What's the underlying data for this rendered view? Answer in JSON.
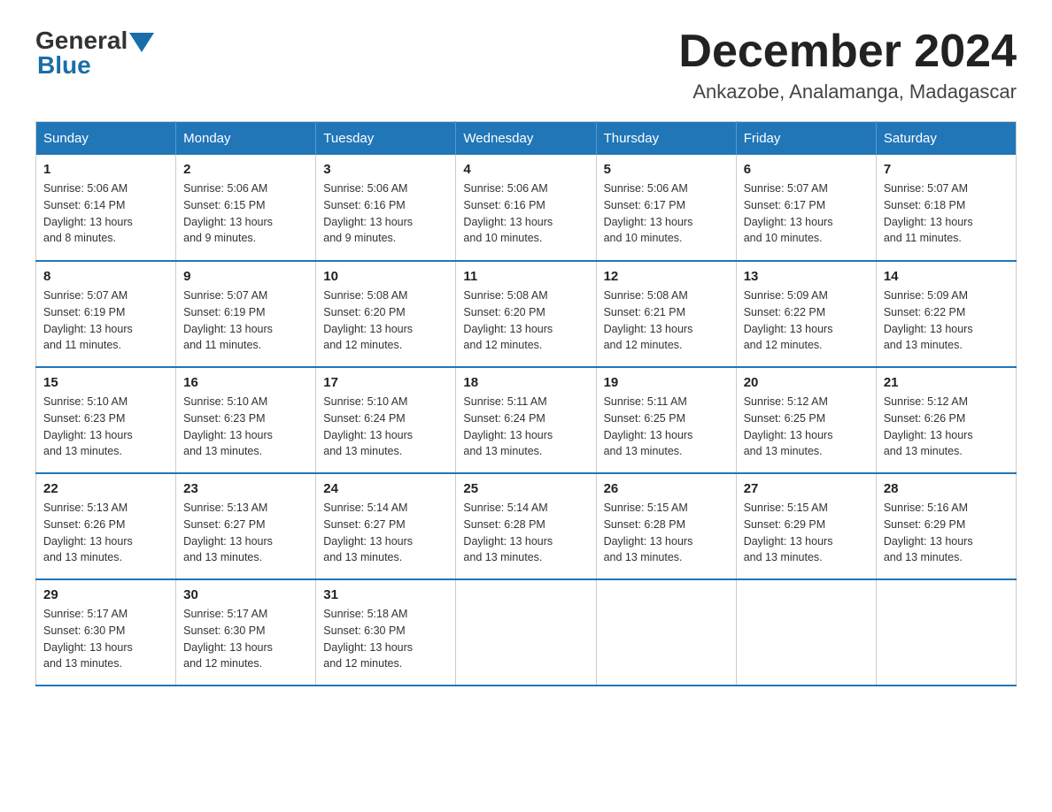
{
  "header": {
    "logo_general": "General",
    "logo_blue": "Blue",
    "title": "December 2024",
    "subtitle": "Ankazobe, Analamanga, Madagascar"
  },
  "weekdays": [
    "Sunday",
    "Monday",
    "Tuesday",
    "Wednesday",
    "Thursday",
    "Friday",
    "Saturday"
  ],
  "weeks": [
    [
      {
        "day": "1",
        "sunrise": "5:06 AM",
        "sunset": "6:14 PM",
        "daylight": "13 hours and 8 minutes."
      },
      {
        "day": "2",
        "sunrise": "5:06 AM",
        "sunset": "6:15 PM",
        "daylight": "13 hours and 9 minutes."
      },
      {
        "day": "3",
        "sunrise": "5:06 AM",
        "sunset": "6:16 PM",
        "daylight": "13 hours and 9 minutes."
      },
      {
        "day": "4",
        "sunrise": "5:06 AM",
        "sunset": "6:16 PM",
        "daylight": "13 hours and 10 minutes."
      },
      {
        "day": "5",
        "sunrise": "5:06 AM",
        "sunset": "6:17 PM",
        "daylight": "13 hours and 10 minutes."
      },
      {
        "day": "6",
        "sunrise": "5:07 AM",
        "sunset": "6:17 PM",
        "daylight": "13 hours and 10 minutes."
      },
      {
        "day": "7",
        "sunrise": "5:07 AM",
        "sunset": "6:18 PM",
        "daylight": "13 hours and 11 minutes."
      }
    ],
    [
      {
        "day": "8",
        "sunrise": "5:07 AM",
        "sunset": "6:19 PM",
        "daylight": "13 hours and 11 minutes."
      },
      {
        "day": "9",
        "sunrise": "5:07 AM",
        "sunset": "6:19 PM",
        "daylight": "13 hours and 11 minutes."
      },
      {
        "day": "10",
        "sunrise": "5:08 AM",
        "sunset": "6:20 PM",
        "daylight": "13 hours and 12 minutes."
      },
      {
        "day": "11",
        "sunrise": "5:08 AM",
        "sunset": "6:20 PM",
        "daylight": "13 hours and 12 minutes."
      },
      {
        "day": "12",
        "sunrise": "5:08 AM",
        "sunset": "6:21 PM",
        "daylight": "13 hours and 12 minutes."
      },
      {
        "day": "13",
        "sunrise": "5:09 AM",
        "sunset": "6:22 PM",
        "daylight": "13 hours and 12 minutes."
      },
      {
        "day": "14",
        "sunrise": "5:09 AM",
        "sunset": "6:22 PM",
        "daylight": "13 hours and 13 minutes."
      }
    ],
    [
      {
        "day": "15",
        "sunrise": "5:10 AM",
        "sunset": "6:23 PM",
        "daylight": "13 hours and 13 minutes."
      },
      {
        "day": "16",
        "sunrise": "5:10 AM",
        "sunset": "6:23 PM",
        "daylight": "13 hours and 13 minutes."
      },
      {
        "day": "17",
        "sunrise": "5:10 AM",
        "sunset": "6:24 PM",
        "daylight": "13 hours and 13 minutes."
      },
      {
        "day": "18",
        "sunrise": "5:11 AM",
        "sunset": "6:24 PM",
        "daylight": "13 hours and 13 minutes."
      },
      {
        "day": "19",
        "sunrise": "5:11 AM",
        "sunset": "6:25 PM",
        "daylight": "13 hours and 13 minutes."
      },
      {
        "day": "20",
        "sunrise": "5:12 AM",
        "sunset": "6:25 PM",
        "daylight": "13 hours and 13 minutes."
      },
      {
        "day": "21",
        "sunrise": "5:12 AM",
        "sunset": "6:26 PM",
        "daylight": "13 hours and 13 minutes."
      }
    ],
    [
      {
        "day": "22",
        "sunrise": "5:13 AM",
        "sunset": "6:26 PM",
        "daylight": "13 hours and 13 minutes."
      },
      {
        "day": "23",
        "sunrise": "5:13 AM",
        "sunset": "6:27 PM",
        "daylight": "13 hours and 13 minutes."
      },
      {
        "day": "24",
        "sunrise": "5:14 AM",
        "sunset": "6:27 PM",
        "daylight": "13 hours and 13 minutes."
      },
      {
        "day": "25",
        "sunrise": "5:14 AM",
        "sunset": "6:28 PM",
        "daylight": "13 hours and 13 minutes."
      },
      {
        "day": "26",
        "sunrise": "5:15 AM",
        "sunset": "6:28 PM",
        "daylight": "13 hours and 13 minutes."
      },
      {
        "day": "27",
        "sunrise": "5:15 AM",
        "sunset": "6:29 PM",
        "daylight": "13 hours and 13 minutes."
      },
      {
        "day": "28",
        "sunrise": "5:16 AM",
        "sunset": "6:29 PM",
        "daylight": "13 hours and 13 minutes."
      }
    ],
    [
      {
        "day": "29",
        "sunrise": "5:17 AM",
        "sunset": "6:30 PM",
        "daylight": "13 hours and 13 minutes."
      },
      {
        "day": "30",
        "sunrise": "5:17 AM",
        "sunset": "6:30 PM",
        "daylight": "13 hours and 12 minutes."
      },
      {
        "day": "31",
        "sunrise": "5:18 AM",
        "sunset": "6:30 PM",
        "daylight": "13 hours and 12 minutes."
      },
      null,
      null,
      null,
      null
    ]
  ],
  "labels": {
    "sunrise": "Sunrise:",
    "sunset": "Sunset:",
    "daylight": "Daylight:"
  }
}
